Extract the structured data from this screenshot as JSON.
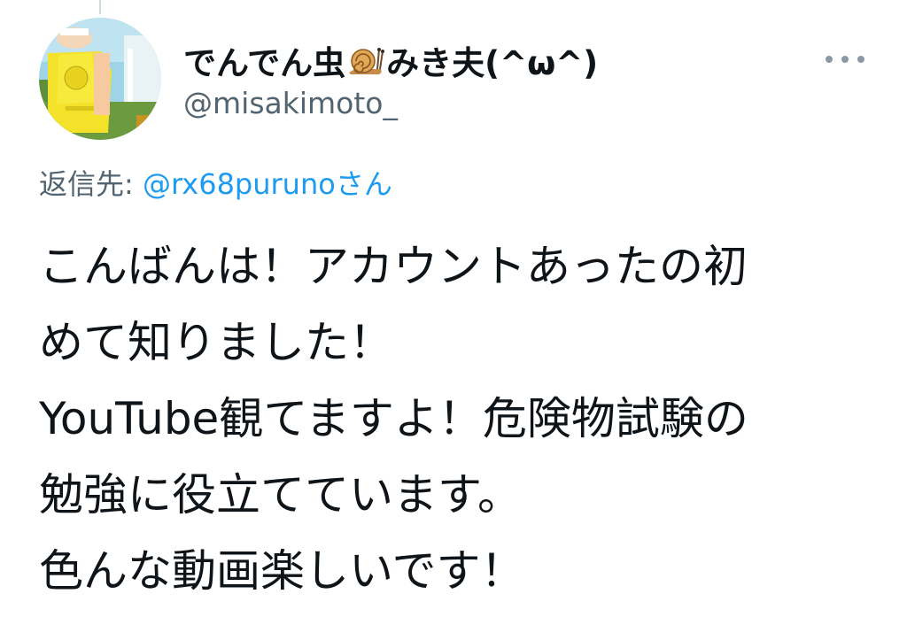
{
  "author": {
    "display_name_part1": "でんでん虫",
    "display_name_part2": "みき夫(^ω^)",
    "handle": "@misakimoto_",
    "avatar_icon": "profile-avatar",
    "name_emoji_icon": "snail-icon"
  },
  "reply": {
    "label": "返信先: ",
    "mention": "@rx68puruno",
    "suffix": "さん"
  },
  "tweet": {
    "lines": [
      "こんばんは！アカウントあったの初",
      "めて知りました！",
      "YouTube観てますよ！危険物試験の",
      "勉強に役立てています。",
      "色んな動画楽しいです！"
    ]
  },
  "colors": {
    "text_primary": "#0f1419",
    "text_secondary": "#536471",
    "link": "#1d9bf0",
    "more_dots": "#8b98a5"
  },
  "menu": {
    "more_icon": "more-icon"
  }
}
